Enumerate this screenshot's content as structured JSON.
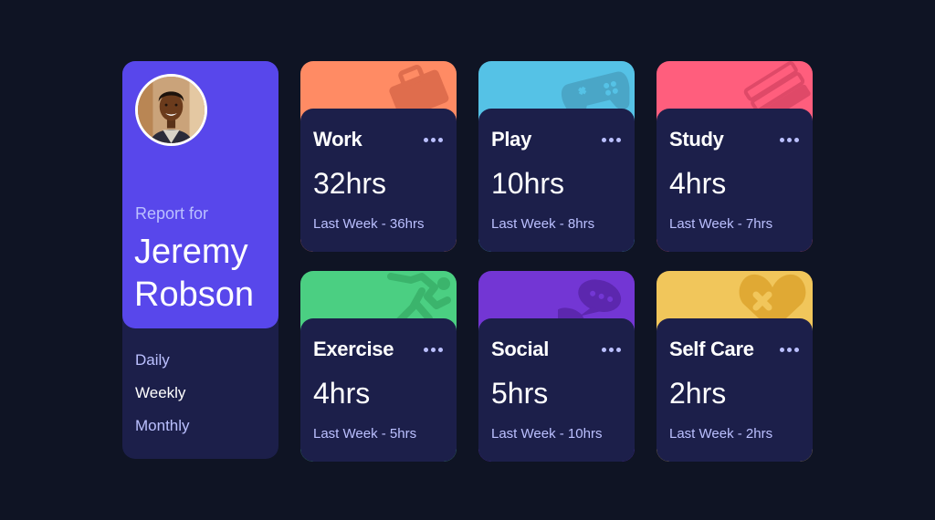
{
  "profile": {
    "report_for": "Report for",
    "name": "Jeremy Robson"
  },
  "periods": [
    "Daily",
    "Weekly",
    "Monthly"
  ],
  "cards": [
    {
      "title": "Work",
      "current": "32hrs",
      "previous": "Last Week - 36hrs",
      "color": "#ff8b64",
      "icon": "briefcase-icon"
    },
    {
      "title": "Play",
      "current": "10hrs",
      "previous": "Last Week - 8hrs",
      "color": "#55c2e6",
      "icon": "gamepad-icon"
    },
    {
      "title": "Study",
      "current": "4hrs",
      "previous": "Last Week - 7hrs",
      "color": "#ff5e7d",
      "icon": "book-icon"
    },
    {
      "title": "Exercise",
      "current": "4hrs",
      "previous": "Last Week - 5hrs",
      "color": "#4bcf82",
      "icon": "running-icon"
    },
    {
      "title": "Social",
      "current": "5hrs",
      "previous": "Last Week - 10hrs",
      "color": "#7336d4",
      "icon": "chat-icon"
    },
    {
      "title": "Self Care",
      "current": "2hrs",
      "previous": "Last Week - 2hrs",
      "color": "#f1c65b",
      "icon": "heart-bandage-icon"
    }
  ]
}
